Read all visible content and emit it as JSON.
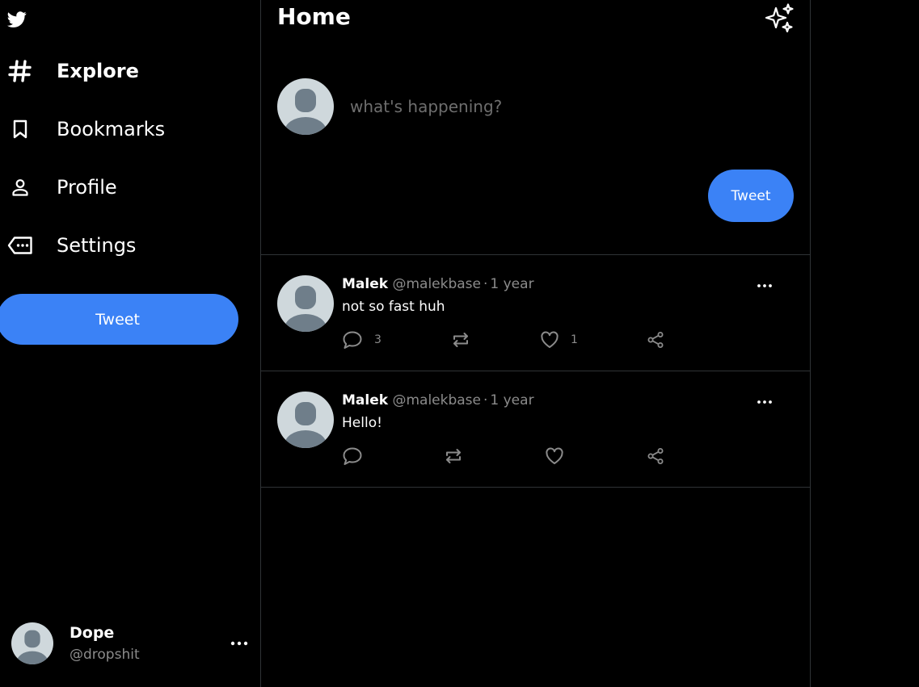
{
  "sidebar": {
    "logo_icon": "twitter-bird-icon",
    "items": [
      {
        "label": "Explore",
        "icon": "hash-icon",
        "active": true
      },
      {
        "label": "Bookmarks",
        "icon": "bookmark-icon",
        "active": false
      },
      {
        "label": "Profile",
        "icon": "user-icon",
        "active": false
      },
      {
        "label": "Settings",
        "icon": "settings-tag-icon",
        "active": false
      }
    ],
    "tweet_label": "Tweet",
    "account": {
      "name": "Dope",
      "handle": "@dropshit",
      "more_icon": "ellipsis-icon"
    }
  },
  "main": {
    "title": "Home",
    "top_icon": "sparkle-icon",
    "composer": {
      "placeholder": "what's happening?",
      "value": "",
      "tweet_label": "Tweet"
    },
    "posts": [
      {
        "name": "Malek",
        "handle": "@malekbase",
        "separator": "·",
        "time": "1 year",
        "text": "not so fast huh",
        "replies": "3",
        "retweets": "",
        "likes": "1"
      },
      {
        "name": "Malek",
        "handle": "@malekbase",
        "separator": "·",
        "time": "1 year",
        "text": "Hello!",
        "replies": "",
        "retweets": "",
        "likes": ""
      }
    ]
  },
  "colors": {
    "background": "#000000",
    "accent": "#3b82f6",
    "muted_text": "#8b8b8b",
    "border": "#2f3336",
    "avatar_bg": "#cfd8dc",
    "avatar_fg": "#6f7e8a"
  }
}
